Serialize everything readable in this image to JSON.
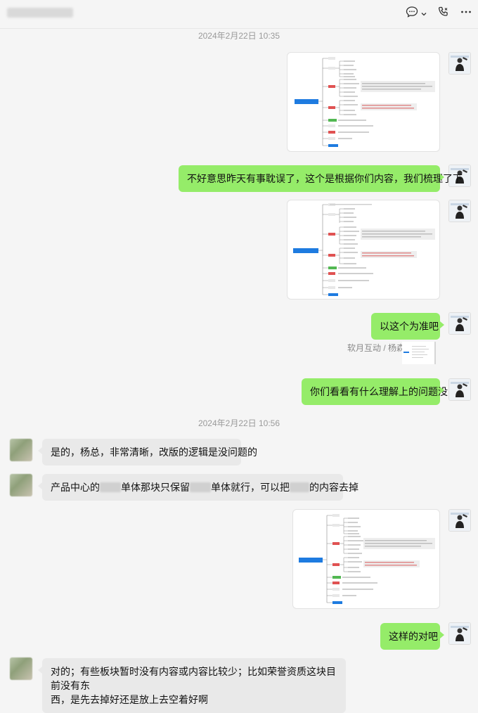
{
  "header": {
    "icons": [
      "chat-icon",
      "chevron-down-icon",
      "phone-icon",
      "more-icon"
    ]
  },
  "messages": {
    "ts1": "2024年2月22日 10:35",
    "m2": "不好意思昨天有事耽误了，这个是根据你们内容，我们梳理了下",
    "m4": "以这个为准吧",
    "quote_label": "软月互动 / 杨森:",
    "m5": "你们看看有什么理解上的问题没",
    "ts2": "2024年2月22日 10:56",
    "m6": "是的，杨总，非常清晰，改版的逻辑是没问题的",
    "m7_a": "产品中心的",
    "m7_b": "单体那块只保留",
    "m7_c": "单体就行，可以把",
    "m7_d": "的内容去掉",
    "m9": "这样的对吧",
    "m10_line1": "对的；有些板块暂时没有内容或内容比较少；比如荣誉资质这块目前没有东",
    "m10_line2": "西，是先去掉好还是放上去空着好啊"
  },
  "colors": {
    "my_bubble": "#95ec69",
    "other_bubble": "#e9e9e9",
    "background": "#f5f5f5",
    "mindmap_root": "#1e7be0",
    "mindmap_red": "#e05252",
    "mindmap_green": "#52b852"
  }
}
